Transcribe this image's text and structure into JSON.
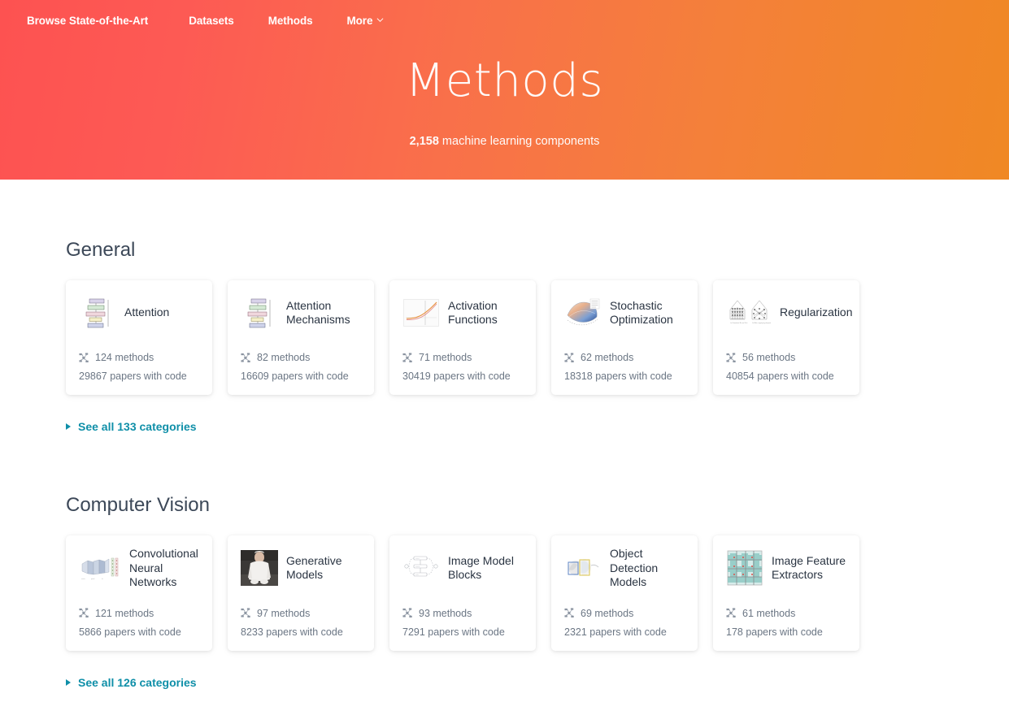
{
  "nav": {
    "items": [
      {
        "label": "Browse State-of-the-Art",
        "icon": null
      },
      {
        "label": "Datasets",
        "icon": null
      },
      {
        "label": "Methods",
        "icon": null
      },
      {
        "label": "More",
        "icon": "chevron-down-icon"
      }
    ]
  },
  "hero": {
    "title": "Methods",
    "count": "2,158",
    "subtitle_rest": " machine learning components",
    "gradient_from": "#fd5251",
    "gradient_to": "#f08824"
  },
  "link_color": "#0f8fa8",
  "sections": [
    {
      "id": "general",
      "title": "General",
      "see_all": "See all 133 categories",
      "cards": [
        {
          "name": "Attention",
          "methods": "124 methods",
          "papers": "29867 papers with code",
          "thumb": "transformer-blocks-thumb",
          "methods_icon": "network-icon"
        },
        {
          "name": "Attention Mechanisms",
          "methods": "82 methods",
          "papers": "16609 papers with code",
          "thumb": "transformer-blocks-thumb",
          "methods_icon": "network-icon"
        },
        {
          "name": "Activation Functions",
          "methods": "71 methods",
          "papers": "30419 papers with code",
          "thumb": "activation-curve-thumb",
          "methods_icon": "network-icon"
        },
        {
          "name": "Stochastic Optimization",
          "methods": "62 methods",
          "papers": "18318 papers with code",
          "thumb": "loss-surface-thumb",
          "methods_icon": "network-icon"
        },
        {
          "name": "Regularization",
          "methods": "56 methods",
          "papers": "40854 papers with code",
          "thumb": "dropout-nets-thumb",
          "methods_icon": "network-icon"
        }
      ]
    },
    {
      "id": "cv",
      "title": "Computer Vision",
      "see_all": "See all 126 categories",
      "cards": [
        {
          "name": "Convolutional Neural Networks",
          "methods": "121 methods",
          "papers": "5866 papers with code",
          "thumb": "cnn-layers-thumb",
          "methods_icon": "network-icon"
        },
        {
          "name": "Generative Models",
          "methods": "97 methods",
          "papers": "8233 papers with code",
          "thumb": "person-photo-thumb",
          "methods_icon": "network-icon"
        },
        {
          "name": "Image Model Blocks",
          "methods": "93 methods",
          "papers": "7291 papers with code",
          "thumb": "block-diagram-thumb",
          "methods_icon": "network-icon"
        },
        {
          "name": "Object Detection Models",
          "methods": "69 methods",
          "papers": "2321 papers with code",
          "thumb": "detection-boxes-thumb",
          "methods_icon": "network-icon"
        },
        {
          "name": "Image Feature Extractors",
          "methods": "61 methods",
          "papers": "178 papers with code",
          "thumb": "teal-grid-thumb",
          "methods_icon": "network-icon"
        }
      ]
    }
  ]
}
